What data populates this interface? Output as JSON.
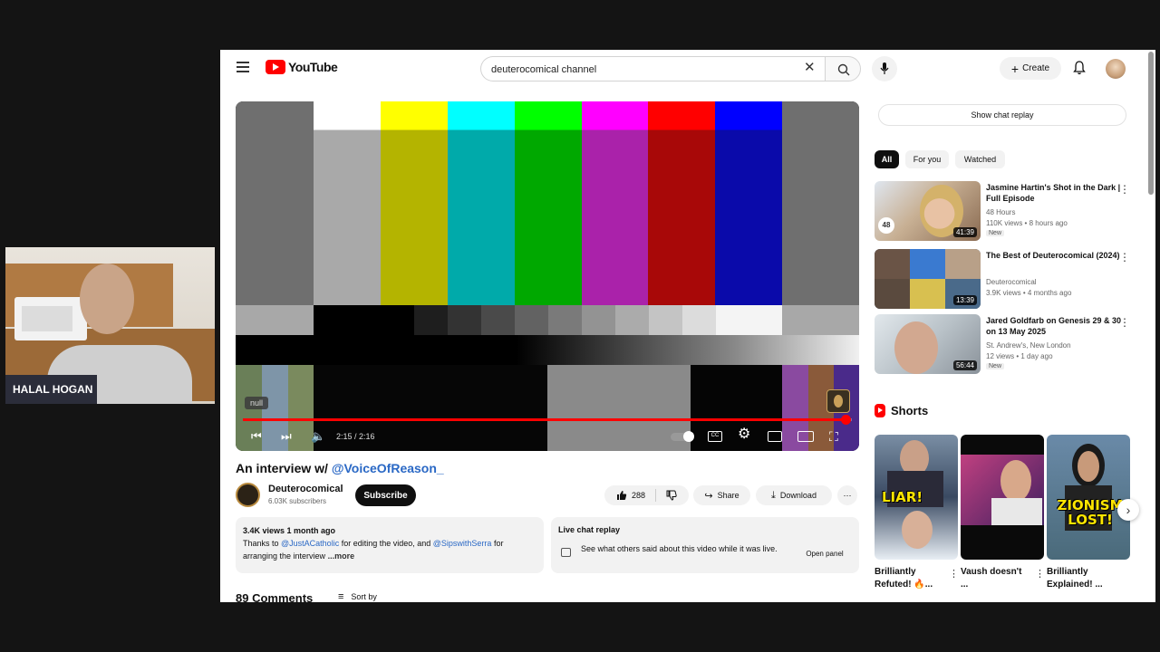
{
  "webcam": {
    "name_tag": "HALAL HOGAN"
  },
  "header": {
    "logo_text": "YouTube",
    "search_value": "deuterocomical channel",
    "search_placeholder": "Search",
    "clear_glyph": "✕",
    "create_label": "Create"
  },
  "player": {
    "tooltip": "null",
    "time": "2:15 / 2:16",
    "progress_percent": 99
  },
  "video": {
    "title_text": "An interview w/ ",
    "title_mention": "@VoiceOfReason_",
    "channel_name": "Deuterocomical",
    "subscribers": "6.03K subscribers",
    "subscribe_label": "Subscribe",
    "likes": "288",
    "share_label": "Share",
    "download_label": "Download",
    "more_glyph": "⋯"
  },
  "description": {
    "stats": "3.4K views  1 month ago",
    "text_1": "Thanks to ",
    "mention_1": "@JustACatholic",
    "text_2": " for editing the video, and ",
    "mention_2": "@SipswithSerra",
    "text_3": " for arranging the interview",
    "more": " ...more"
  },
  "live_replay": {
    "title": "Live chat replay",
    "text": "See what others said about this video while it was live.",
    "button": "Open panel"
  },
  "comments": {
    "heading": "89 Comments",
    "sort_label": "Sort by"
  },
  "sidebar": {
    "chat_replay_button": "Show chat replay",
    "chips": [
      "All",
      "For you",
      "Watched"
    ],
    "recommendations": [
      {
        "title": "Jasmine Hartin's Shot in the Dark | Full Episode",
        "channel": "48 Hours",
        "meta": "110K views  •  8 hours ago",
        "badge": "New",
        "duration": "41:39"
      },
      {
        "title": "The Best of Deuterocomical (2024)",
        "channel": "Deuterocomical",
        "meta": "3.9K views  •  4 months ago",
        "badge": "",
        "duration": "13:39"
      },
      {
        "title": "Jared Goldfarb on Genesis 29 & 30 on 13 May 2025",
        "channel": "St. Andrew's, New London",
        "meta": "12 views  •  1 day ago",
        "badge": "New",
        "duration": "56:44"
      }
    ],
    "shorts_heading": "Shorts",
    "shorts": [
      {
        "title": "Brilliantly Refuted! 🔥...",
        "overlay": "LIAR!"
      },
      {
        "title": "Vaush doesn't ...",
        "overlay": ""
      },
      {
        "title": "Brilliantly Explained! ...",
        "overlay": "ZIONISM LOST!"
      }
    ]
  },
  "colors": {
    "accent": "#ff0000",
    "link": "#2a68c5",
    "chip_active": "#0f0f0f"
  }
}
